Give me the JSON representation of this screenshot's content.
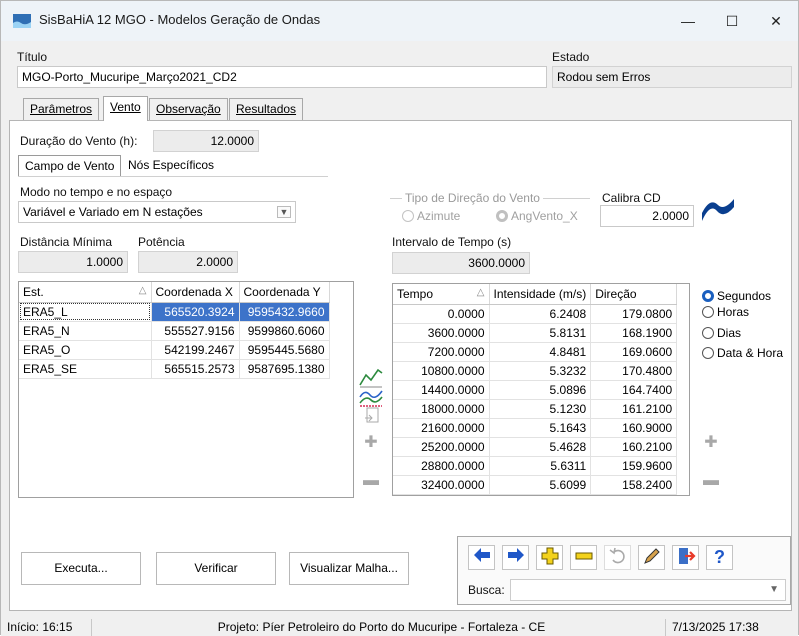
{
  "window": {
    "title": "SisBaHiA 12 MGO - Modelos Geração de Ondas",
    "controls": [
      "—",
      "☐",
      "✕"
    ]
  },
  "form": {
    "titulo_label": "Título",
    "titulo_value": "MGO-Porto_Mucuripe_Março2021_CD2",
    "estado_label": "Estado",
    "estado_value": "Rodou sem Erros"
  },
  "tabs": [
    {
      "label": "Parâmetros",
      "active": false
    },
    {
      "label": "Vento",
      "active": true
    },
    {
      "label": "Observação",
      "active": false
    },
    {
      "label": "Resultados",
      "active": false
    }
  ],
  "vento": {
    "duracao_label": "Duração do Vento (h):",
    "duracao_value": "12.0000",
    "subtabs": [
      "Campo de Vento",
      "Nós Específicos"
    ],
    "modo_label": "Modo no tempo e no espaço",
    "modo_value": "Variável e Variado em N estações",
    "dist_label": "Distância Mínima",
    "dist_value": "1.0000",
    "potencia_label": "Potência",
    "potencia_value": "2.0000",
    "tipo_dir_label": "Tipo de Direção do Vento",
    "tipo_dir_options": [
      "Azimute",
      "AngVento_X"
    ],
    "calibra_label": "Calibra CD",
    "calibra_value": "2.0000",
    "intervalo_label": "Intervalo de Tempo (s)",
    "intervalo_value": "3600.0000"
  },
  "stations": {
    "headers": [
      "Est.",
      "Coordenada X",
      "Coordenada Y"
    ],
    "rows": [
      [
        "ERA5_L",
        "565520.3924",
        "9595432.9660"
      ],
      [
        "ERA5_N",
        "555527.9156",
        "9599860.6060"
      ],
      [
        "ERA5_O",
        "542199.2467",
        "9595445.5680"
      ],
      [
        "ERA5_SE",
        "565515.2573",
        "9587695.1380"
      ]
    ]
  },
  "series": {
    "headers": [
      "Tempo",
      "Intensidade (m/s)",
      "Direção"
    ],
    "rows": [
      [
        "0.0000",
        "6.2408",
        "179.0800"
      ],
      [
        "3600.0000",
        "5.8131",
        "168.1900"
      ],
      [
        "7200.0000",
        "4.8481",
        "169.0600"
      ],
      [
        "10800.0000",
        "5.3232",
        "170.4800"
      ],
      [
        "14400.0000",
        "5.0896",
        "164.7400"
      ],
      [
        "18000.0000",
        "5.1230",
        "161.2100"
      ],
      [
        "21600.0000",
        "5.1643",
        "160.9000"
      ],
      [
        "25200.0000",
        "5.4628",
        "160.2100"
      ],
      [
        "28800.0000",
        "5.6311",
        "159.9600"
      ],
      [
        "32400.0000",
        "5.6099",
        "158.2400"
      ]
    ]
  },
  "time_units": [
    {
      "label": "Segundos",
      "checked": true
    },
    {
      "label": "Horas",
      "checked": false
    },
    {
      "label": "Dias",
      "checked": false
    },
    {
      "label": "Data & Hora",
      "checked": false
    }
  ],
  "buttons": {
    "executa": "Executa...",
    "verificar": "Verificar",
    "visualizar": "Visualizar Malha..."
  },
  "toolbox": {
    "busca_label": "Busca:",
    "busca_value": "",
    "icons": [
      "arrow-left-icon",
      "arrow-right-icon",
      "add-icon",
      "remove-icon",
      "undo-icon",
      "edit-icon",
      "exit-icon",
      "help-icon"
    ]
  },
  "statusbar": {
    "inicio": "Início: 16:15",
    "projeto": "Projeto: Píer Petroleiro do Porto do Mucuripe - Fortaleza - CE",
    "datetime": "7/13/2025 17:38"
  },
  "colors": {
    "selection": "#3d73c9",
    "accent_blue": "#1a5fbf",
    "arrow_blue": "#1f57c8",
    "yellow": "#f3d21b"
  }
}
